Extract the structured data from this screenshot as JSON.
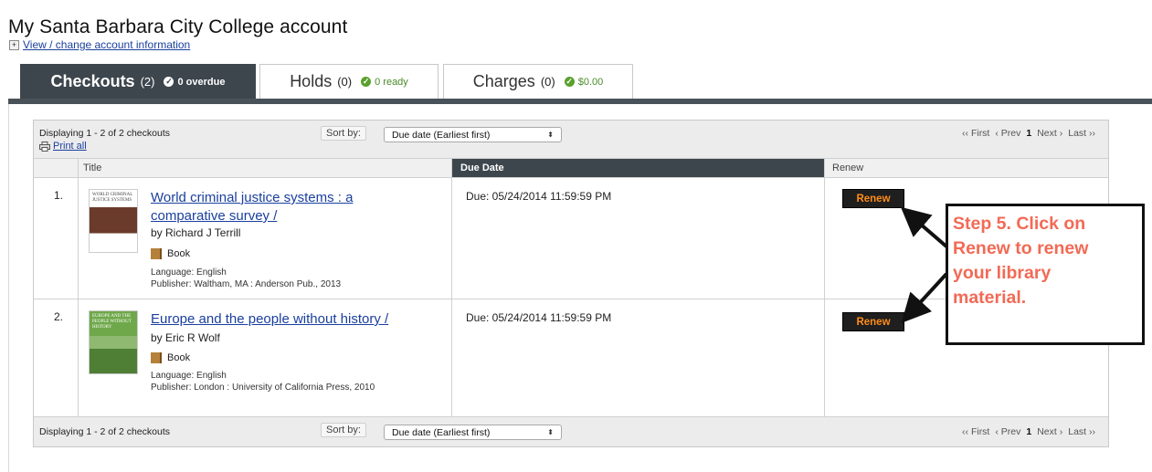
{
  "header": {
    "title": "My Santa Barbara City College account",
    "account_link": "View / change account information"
  },
  "tabs": [
    {
      "label": "Checkouts",
      "count": "(2)",
      "status": "0 overdue"
    },
    {
      "label": "Holds",
      "count": "(0)",
      "status": "0 ready"
    },
    {
      "label": "Charges",
      "count": "(0)",
      "status": "$0.00"
    }
  ],
  "toolbar": {
    "displaying": "Displaying 1 - 2 of 2 checkouts",
    "print_all": "Print all",
    "sort_label": "Sort by:",
    "sort_value": "Due date (Earliest first)",
    "pager": {
      "first": "‹‹ First",
      "prev": "‹ Prev",
      "page": "1",
      "next": "Next ›",
      "last": "Last ››"
    }
  },
  "columns": {
    "title": "Title",
    "due": "Due Date",
    "renew": "Renew"
  },
  "items": [
    {
      "num": "1.",
      "title_line1": "World criminal justice systems : a",
      "title_line2": "comparative survey /",
      "author": "by Richard J Terrill",
      "format": "Book",
      "language": "Language: English",
      "publisher": "Publisher: Waltham, MA : Anderson Pub., 2013",
      "due": "Due: 05/24/2014 11:59:59 PM",
      "renew": "Renew",
      "cover_text": "WORLD CRIMINAL JUSTICE SYSTEMS"
    },
    {
      "num": "2.",
      "title_line1": "Europe and the people without history /",
      "author": "by Eric R Wolf",
      "format": "Book",
      "language": "Language: English",
      "publisher": "Publisher: London : University of California Press, 2010",
      "due": "Due: 05/24/2014 11:59:59 PM",
      "renew": "Renew",
      "cover_text": "EUROPE AND THE PEOPLE WITHOUT HISTORY"
    }
  ],
  "callout": {
    "lines": [
      "Step 5. Click on",
      "Renew to renew",
      "your library",
      "material."
    ]
  },
  "colors": {
    "accent_tab": "#3d464d",
    "link": "#1a3f9e",
    "renew_text": "#ff8c1a",
    "callout_text": "#f26a55",
    "status_ok": "#5aa02c"
  }
}
